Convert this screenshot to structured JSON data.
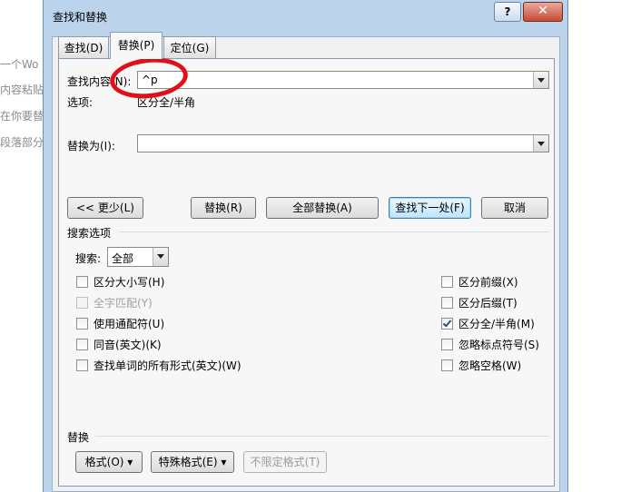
{
  "background_text": [
    "一个Wo",
    "内容粘贴",
    "在你要替",
    "段落部分"
  ],
  "dialog": {
    "title": "查找和替换",
    "help_glyph": "?",
    "close_glyph": "✕",
    "tabs": [
      {
        "label": "查找(D)",
        "active": false
      },
      {
        "label": "替换(P)",
        "active": true
      },
      {
        "label": "定位(G)",
        "active": false
      }
    ],
    "find": {
      "label": "查找内容(N):",
      "value": "^p"
    },
    "options": {
      "label": "选项:",
      "value": "区分全/半角"
    },
    "replace": {
      "label": "替换为(I):",
      "value": ""
    },
    "buttons": {
      "less": "<< 更少(L)",
      "replace": "替换(R)",
      "replace_all": "全部替换(A)",
      "find_next": "查找下一处(F)",
      "cancel": "取消"
    },
    "search_options": {
      "heading": "搜索选项",
      "search_label": "搜索:",
      "search_value": "全部",
      "left": [
        {
          "label": "区分大小写(H)",
          "checked": false,
          "enabled": true
        },
        {
          "label": "全字匹配(Y)",
          "checked": false,
          "enabled": false
        },
        {
          "label": "使用通配符(U)",
          "checked": false,
          "enabled": true
        },
        {
          "label": "同音(英文)(K)",
          "checked": false,
          "enabled": true
        },
        {
          "label": "查找单词的所有形式(英文)(W)",
          "checked": false,
          "enabled": true
        }
      ],
      "right": [
        {
          "label": "区分前缀(X)",
          "checked": false,
          "enabled": true
        },
        {
          "label": "区分后缀(T)",
          "checked": false,
          "enabled": true
        },
        {
          "label": "区分全/半角(M)",
          "checked": true,
          "enabled": true
        },
        {
          "label": "忽略标点符号(S)",
          "checked": false,
          "enabled": true
        },
        {
          "label": "忽略空格(W)",
          "checked": false,
          "enabled": true
        }
      ]
    },
    "replace_section": {
      "heading": "替换",
      "format": "格式(O) ▾",
      "special": "特殊格式(E) ▾",
      "no_format": "不限定格式(T)"
    }
  },
  "colors": {
    "annotation_ring": "#e0101a",
    "close_button": "#c74b34",
    "checkbox_check": "#2a4f8c"
  }
}
